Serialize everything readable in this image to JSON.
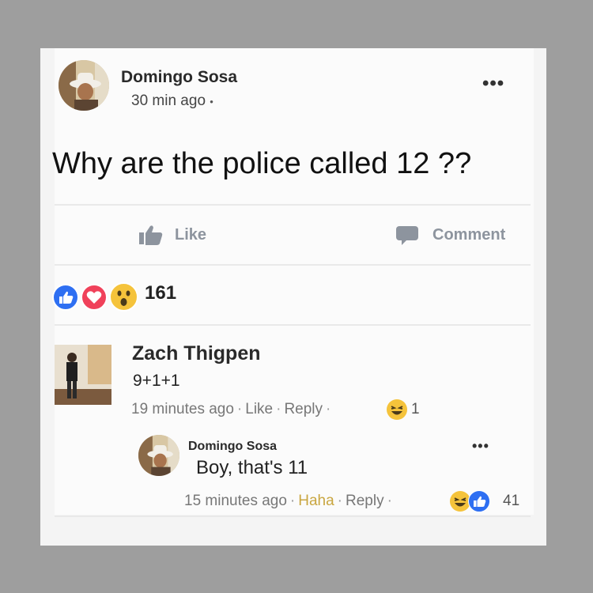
{
  "post": {
    "author": "Domingo Sosa",
    "time": "30 min ago",
    "time_sep": "•",
    "more_label": "•••",
    "text": "Why are the police called 12 ??"
  },
  "actions": {
    "like_label": "Like",
    "comment_label": "Comment"
  },
  "reactions": {
    "count": "161",
    "icons": [
      "like-reaction-icon",
      "love-reaction-icon",
      "wow-reaction-icon"
    ],
    "colors": {
      "like": "#2e6ff2",
      "love": "#f0415a",
      "wow": "#f5c33b"
    }
  },
  "comment": {
    "author": "Zach Thigpen",
    "text": "9+1+1",
    "time": "19 minutes ago",
    "like_label": "Like",
    "reply_label": "Reply",
    "sep": "·",
    "reaction_count": "1"
  },
  "reply": {
    "author": "Domingo Sosa",
    "text": "Boy, that's 11",
    "time": "15 minutes ago",
    "haha_label": "Haha",
    "reply_label": "Reply",
    "sep": "·",
    "reaction_count": "41",
    "more_label": "•••"
  },
  "colors": {
    "haha": "#c9a640",
    "muted": "#8d949e"
  }
}
